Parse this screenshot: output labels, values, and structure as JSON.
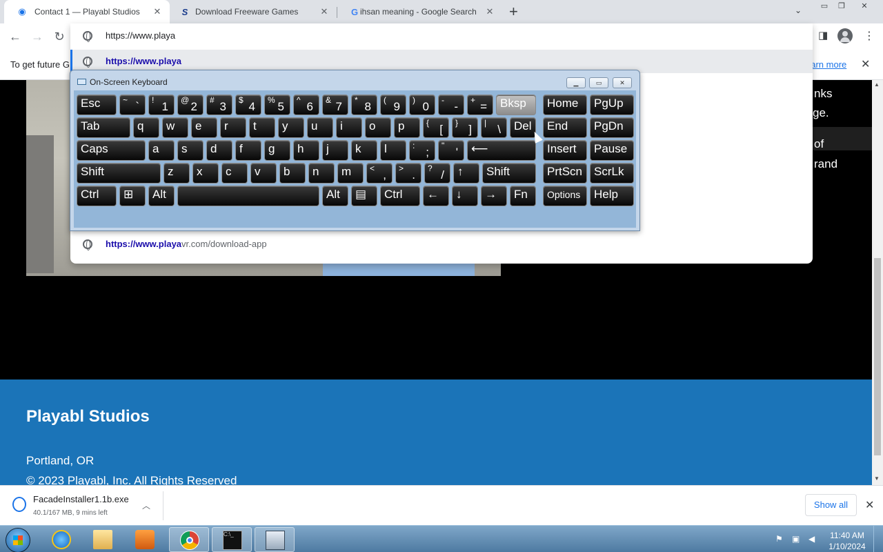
{
  "tabs": [
    {
      "title": "Contact 1 — Playabl Studios",
      "icon": "playabl-icon",
      "active": true
    },
    {
      "title": "Download Freeware Games",
      "icon": "s-icon",
      "active": false
    },
    {
      "title": "ihsan meaning - Google Search",
      "icon": "google-icon",
      "active": false
    }
  ],
  "tab_close": "✕",
  "new_tab": "+",
  "omnibox": {
    "value": "https://www.playa"
  },
  "suggestions": [
    {
      "bold": "https://www.playa",
      "rest": ""
    },
    {
      "bold": "https://www.playa",
      "rest": "vr.com/download-app"
    }
  ],
  "infobar": {
    "text": "To get future G",
    "link": "earn more",
    "close": "✕"
  },
  "page": {
    "right_text": [
      "nks",
      "ge.",
      "of",
      "rand"
    ],
    "footer": {
      "brand": "Playabl Studios",
      "location": "Portland, OR",
      "copyright": "© 2023 Playabl, Inc. All Rights Reserved"
    }
  },
  "osk": {
    "title": "On-Screen Keyboard",
    "rows": [
      [
        {
          "m": "Esc",
          "w": 60
        },
        {
          "s": "~",
          "u": "`",
          "w": 40
        },
        {
          "s": "!",
          "u": "1",
          "w": 40
        },
        {
          "s": "@",
          "u": "2",
          "w": 40
        },
        {
          "s": "#",
          "u": "3",
          "w": 40
        },
        {
          "s": "$",
          "u": "4",
          "w": 40
        },
        {
          "s": "%",
          "u": "5",
          "w": 40
        },
        {
          "s": "^",
          "u": "6",
          "w": 40
        },
        {
          "s": "&",
          "u": "7",
          "w": 40
        },
        {
          "s": "*",
          "u": "8",
          "w": 40
        },
        {
          "s": "(",
          "u": "9",
          "w": 40
        },
        {
          "s": ")",
          "u": "0",
          "w": 40
        },
        {
          "s": "-",
          "u": "-",
          "w": 40
        },
        {
          "s": "+",
          "u": "=",
          "w": 40
        },
        {
          "m": "Bksp",
          "w": 60,
          "hl": true
        },
        {
          "m": "Home",
          "w": 66,
          "gap": true
        },
        {
          "m": "PgUp",
          "w": 66
        }
      ],
      [
        {
          "m": "Tab",
          "w": 80
        },
        {
          "m": "q",
          "w": 40
        },
        {
          "m": "w",
          "w": 40
        },
        {
          "m": "e",
          "w": 40
        },
        {
          "m": "r",
          "w": 40
        },
        {
          "m": "t",
          "w": 40
        },
        {
          "m": "y",
          "w": 40
        },
        {
          "m": "u",
          "w": 40
        },
        {
          "m": "i",
          "w": 40
        },
        {
          "m": "o",
          "w": 40
        },
        {
          "m": "p",
          "w": 40
        },
        {
          "s": "{",
          "u": "[",
          "w": 40
        },
        {
          "s": "}",
          "u": "]",
          "w": 40
        },
        {
          "s": "|",
          "u": "\\",
          "w": 40
        },
        {
          "m": "Del",
          "w": 40
        },
        {
          "m": "End",
          "w": 66,
          "gap": true
        },
        {
          "m": "PgDn",
          "w": 66
        }
      ],
      [
        {
          "m": "Caps",
          "w": 102
        },
        {
          "m": "a",
          "w": 40
        },
        {
          "m": "s",
          "w": 40
        },
        {
          "m": "d",
          "w": 40
        },
        {
          "m": "f",
          "w": 40
        },
        {
          "m": "g",
          "w": 40
        },
        {
          "m": "h",
          "w": 40
        },
        {
          "m": "j",
          "w": 40
        },
        {
          "m": "k",
          "w": 40
        },
        {
          "m": "l",
          "w": 40
        },
        {
          "s": ":",
          "u": ";",
          "w": 40
        },
        {
          "s": "\"",
          "u": "'",
          "w": 40
        },
        {
          "m": "⟵",
          "w": 102
        },
        {
          "m": "Insert",
          "w": 66,
          "gap": true
        },
        {
          "m": "Pause",
          "w": 66
        }
      ],
      [
        {
          "m": "Shift",
          "w": 124
        },
        {
          "m": "z",
          "w": 40
        },
        {
          "m": "x",
          "w": 40
        },
        {
          "m": "c",
          "w": 40
        },
        {
          "m": "v",
          "w": 40
        },
        {
          "m": "b",
          "w": 40
        },
        {
          "m": "n",
          "w": 40
        },
        {
          "m": "m",
          "w": 40
        },
        {
          "s": "<",
          "u": ",",
          "w": 40
        },
        {
          "s": ">",
          "u": ".",
          "w": 40
        },
        {
          "s": "?",
          "u": "/",
          "w": 40
        },
        {
          "m": "↑",
          "w": 40
        },
        {
          "m": "Shift",
          "w": 80
        },
        {
          "m": "PrtScn",
          "w": 66,
          "gap": true
        },
        {
          "m": "ScrLk",
          "w": 66
        }
      ],
      [
        {
          "m": "Ctrl",
          "w": 60
        },
        {
          "m": "⊞",
          "w": 40
        },
        {
          "m": "Alt",
          "w": 40
        },
        {
          "m": "",
          "w": 208
        },
        {
          "m": "Alt",
          "w": 40
        },
        {
          "m": "▤",
          "w": 40
        },
        {
          "m": "Ctrl",
          "w": 60
        },
        {
          "m": "←",
          "w": 40
        },
        {
          "m": "↓",
          "w": 40
        },
        {
          "m": "→",
          "w": 40
        },
        {
          "m": "Fn",
          "w": 40
        },
        {
          "m": "Options",
          "w": 66,
          "gap": true,
          "small": true
        },
        {
          "m": "Help",
          "w": 66
        }
      ]
    ]
  },
  "download": {
    "file": "FacadeInstaller1.1b.exe",
    "status": "40.1/167 MB, 9 mins left",
    "show_all": "Show all"
  },
  "clock": {
    "time": "11:40 AM",
    "date": "1/10/2024"
  }
}
